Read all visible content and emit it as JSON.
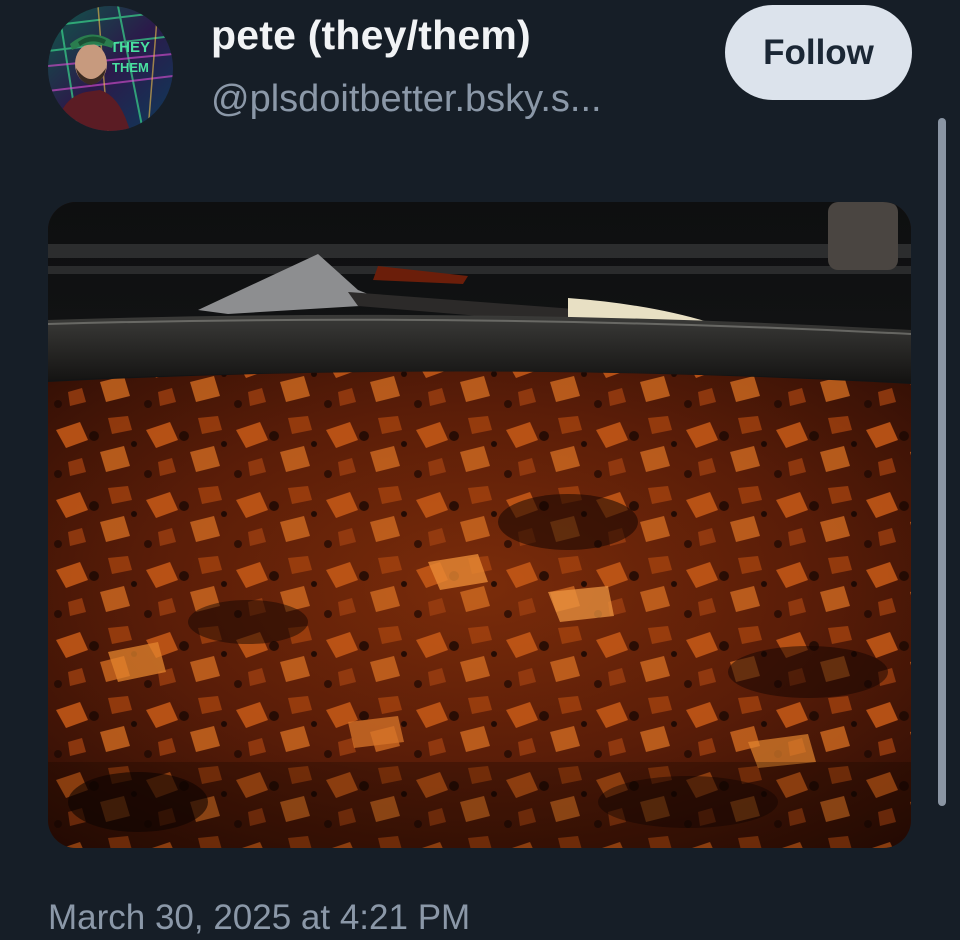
{
  "author": {
    "display_name": "pete (they/them)",
    "handle": "@plsdoitbetter.bsky.s...",
    "avatar_icon": "profile-photo",
    "avatar_text_top": "THEY",
    "avatar_text_bottom": "THEM"
  },
  "follow_button": {
    "label": "Follow"
  },
  "post": {
    "image_icon": "photo",
    "timestamp": "March 30, 2025 at 4:21 PM"
  },
  "colors": {
    "background": "#161e27",
    "primary_text": "#f1f3f5",
    "secondary_text": "#8b98a8",
    "follow_button_bg": "#dce3ec",
    "follow_button_text": "#1b2735"
  }
}
